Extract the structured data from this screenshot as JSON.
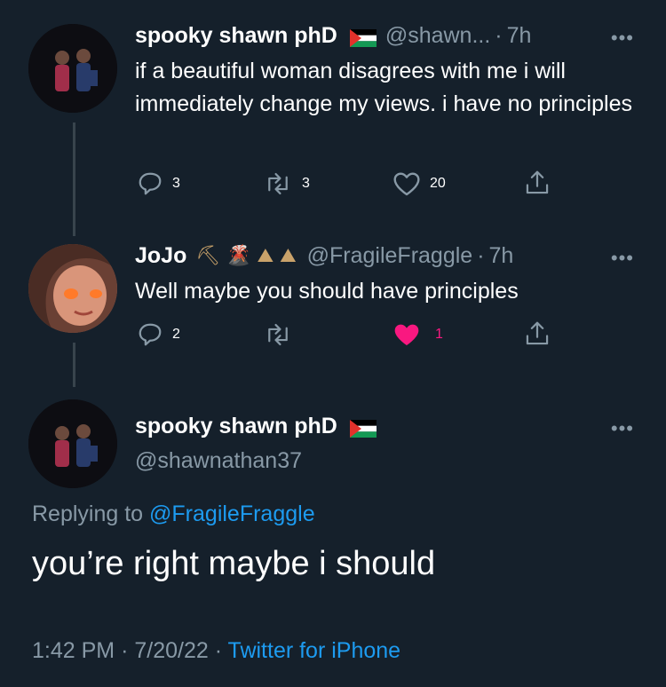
{
  "tweet1": {
    "name": "spooky shawn phD",
    "handle": "@shawn...",
    "sep": "·",
    "time": "7h",
    "more": "•••",
    "text": "if a beautiful woman disagrees with me i will immediately change my views. i have no principles",
    "replies": "3",
    "retweets": "3",
    "likes": "20"
  },
  "tweet2": {
    "name": "JoJo",
    "emojis": "⛏ 🌋 ⛰ ⛰",
    "handle": "@FragileFraggle",
    "sep": "·",
    "time": "7h",
    "more": "•••",
    "text": "Well maybe you should have principles",
    "replies": "2",
    "likes": "1"
  },
  "main_tweet": {
    "name": "spooky shawn phD",
    "handle": "@shawnathan37",
    "more": "•••",
    "replying_label": "Replying to",
    "replying_handle": "@FragileFraggle",
    "text": "you’re right maybe i should",
    "time": "1:42 PM",
    "date": "7/20/22",
    "sep": "·",
    "source": "Twitter for iPhone"
  },
  "colors": {
    "background": "#15202b",
    "secondary_text": "#8899a6",
    "link": "#1d9bf0",
    "like_active": "#f91880"
  }
}
